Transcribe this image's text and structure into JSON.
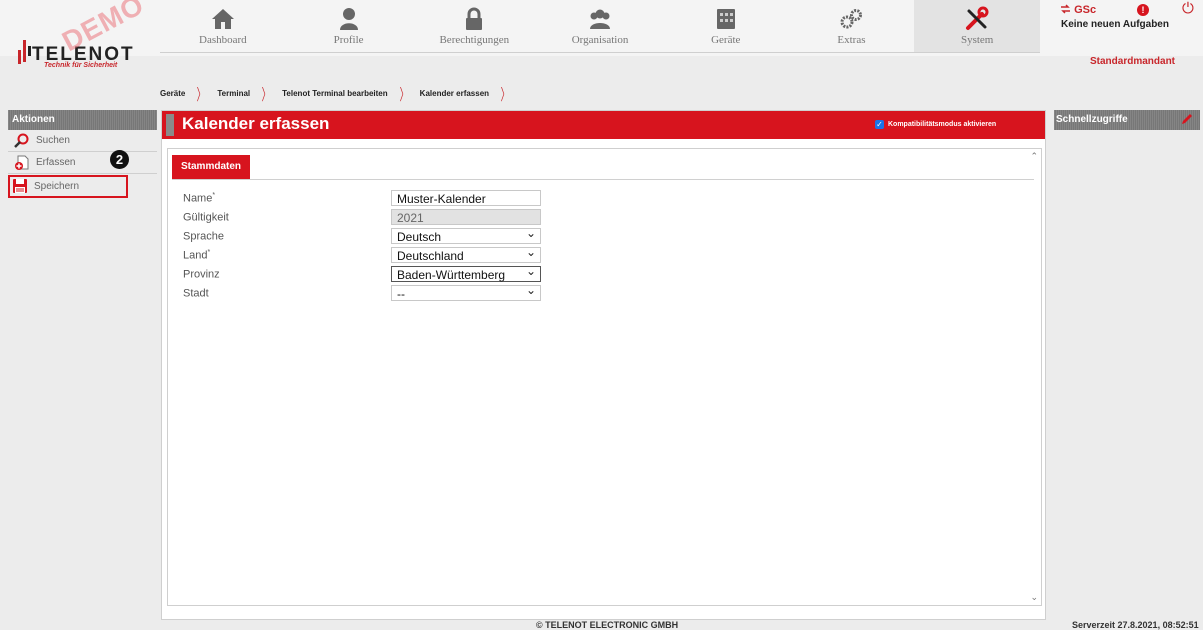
{
  "logo": {
    "brand": "TELENOT",
    "tagline": "Technik für Sicherheit",
    "watermark": "DEMO"
  },
  "nav": [
    {
      "label": "Dashboard",
      "icon": "home-icon"
    },
    {
      "label": "Profile",
      "icon": "user-icon"
    },
    {
      "label": "Berechtigungen",
      "icon": "lock-icon"
    },
    {
      "label": "Organisation",
      "icon": "group-icon"
    },
    {
      "label": "Geräte",
      "icon": "device-icon"
    },
    {
      "label": "Extras",
      "icon": "gears-icon"
    },
    {
      "label": "System",
      "icon": "tools-icon",
      "active": true
    }
  ],
  "user": {
    "name": "GSc",
    "tasks": "Keine neuen Aufgaben",
    "alert": "!",
    "mandant": "Standardmandant"
  },
  "breadcrumb": [
    "Geräte",
    "Terminal",
    "Telenot Terminal bearbeiten",
    "Kalender erfassen"
  ],
  "sidebar": {
    "title": "Aktionen",
    "items": [
      {
        "label": "Suchen",
        "icon": "search-icon"
      },
      {
        "label": "Erfassen",
        "icon": "add-document-icon"
      },
      {
        "label": "Speichern",
        "icon": "save-icon",
        "highlighted": true
      }
    ],
    "step_badge": "2"
  },
  "page": {
    "title": "Kalender erfassen",
    "compat_label": "Kompatibilitätsmodus aktivieren",
    "compat_checked": true,
    "tab": "Stammdaten"
  },
  "form": [
    {
      "label": "Name",
      "required": "*",
      "value": "Muster-Kalender",
      "type": "text"
    },
    {
      "label": "Gültigkeit",
      "required": "",
      "value": "2021",
      "type": "disabled"
    },
    {
      "label": "Sprache",
      "required": "",
      "value": "Deutsch",
      "type": "select"
    },
    {
      "label": "Land",
      "required": "*",
      "value": "Deutschland",
      "type": "select"
    },
    {
      "label": "Provinz",
      "required": "",
      "value": "Baden-Württemberg",
      "type": "select"
    },
    {
      "label": "Stadt",
      "required": "",
      "value": "--",
      "type": "select"
    }
  ],
  "quick": {
    "title": "Schnellzugriffe"
  },
  "footer": {
    "copyright": "© TELENOT ELECTRONIC GMBH",
    "servertime": "Serverzeit 27.8.2021, 08:52:51"
  },
  "colors": {
    "accent": "#d7141e",
    "sidebar_head": "#7a7a7a",
    "background": "#ececec"
  }
}
